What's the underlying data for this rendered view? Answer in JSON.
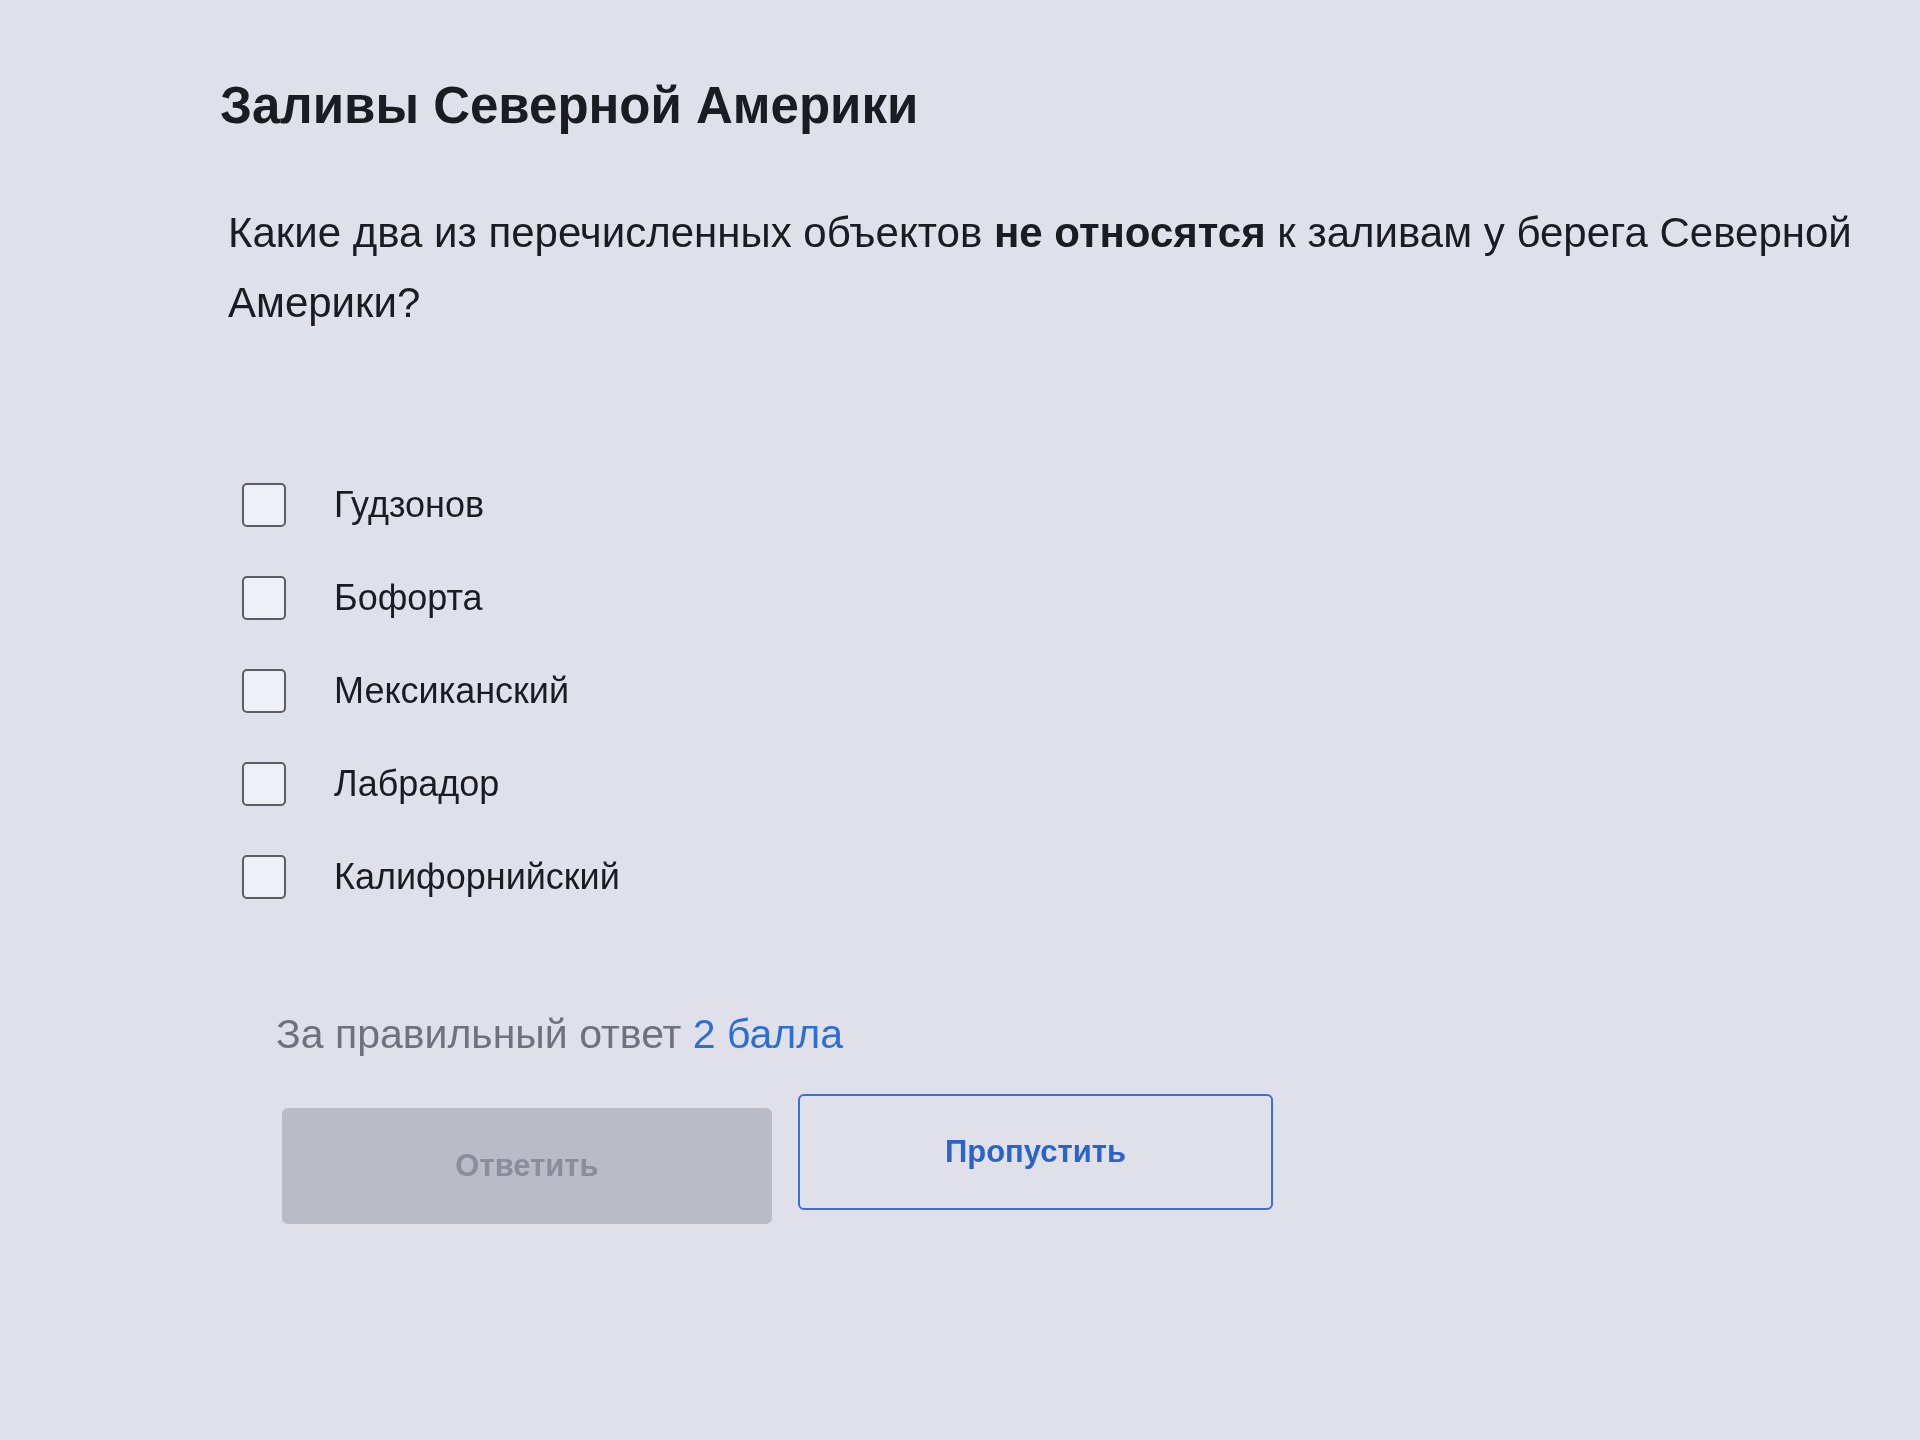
{
  "title": "Заливы Северной Америки",
  "question": "Какие два из перечисленных объектов **не относятся** к заливам у берега Северной Америки?",
  "options": [
    {
      "label": "Гудзонов",
      "checked": false
    },
    {
      "label": "Бофорта",
      "checked": false
    },
    {
      "label": "Мексиканский",
      "checked": false
    },
    {
      "label": "Лабрадор",
      "checked": false
    },
    {
      "label": "Калифорнийский",
      "checked": false
    }
  ],
  "points": {
    "label": "За правильный ответ",
    "value": "2 балла"
  },
  "buttons": [
    {
      "label": "Ответить",
      "kind": "filled",
      "disabled": true
    },
    {
      "label": "Пропустить",
      "kind": "outline",
      "disabled": false
    }
  ]
}
